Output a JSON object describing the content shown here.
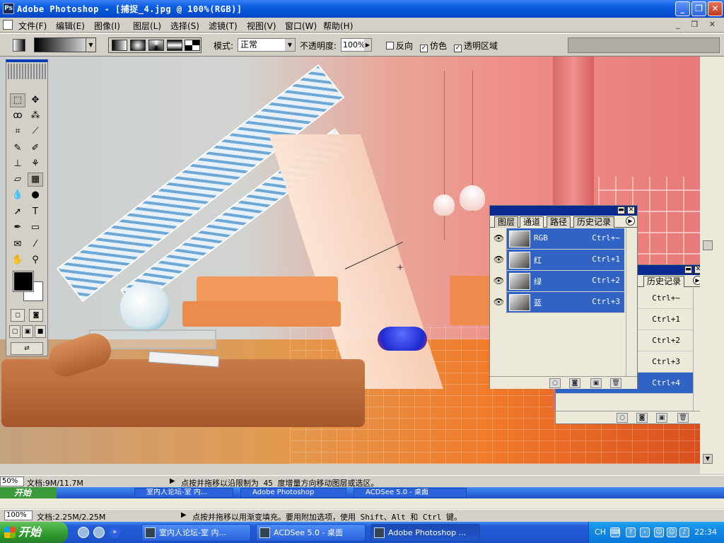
{
  "window": {
    "title": "Adobe Photoshop - [捕捉_4.jpg @ 100%(RGB)]",
    "buttons": [
      "_",
      "❐",
      "✕"
    ]
  },
  "menu": {
    "items": [
      "文件(F)",
      "编辑(E)",
      "图像(I)",
      "图层(L)",
      "选择(S)",
      "滤镜(T)",
      "视图(V)",
      "窗口(W)",
      "帮助(H)"
    ],
    "mdi_buttons": "_ ❐ ✕"
  },
  "options": {
    "mode_label": "模式:",
    "mode_value": "正常",
    "opacity_label": "不透明度:",
    "opacity_value": "100%",
    "reverse_label": "反向",
    "reverse_checked": false,
    "dither_label": "仿色",
    "dither_checked": true,
    "transparency_label": "透明区域",
    "transparency_checked": true
  },
  "channels_panel": {
    "tabs": [
      "图层",
      "通道",
      "路径",
      "历史记录"
    ],
    "active_tab": "通道",
    "rows": [
      {
        "name": "RGB",
        "shortcut": "Ctrl+~"
      },
      {
        "name": "红",
        "shortcut": "Ctrl+1"
      },
      {
        "name": "绿",
        "shortcut": "Ctrl+2"
      },
      {
        "name": "蓝",
        "shortcut": "Ctrl+3"
      }
    ]
  },
  "history_panel": {
    "tab": "历史记录",
    "rows": [
      {
        "shortcut": "Ctrl+~",
        "selected": false
      },
      {
        "shortcut": "Ctrl+1",
        "selected": false
      },
      {
        "shortcut": "Ctrl+2",
        "selected": false
      },
      {
        "shortcut": "Ctrl+3",
        "selected": false
      },
      {
        "shortcut": "Ctrl+4",
        "selected": true
      }
    ]
  },
  "status_inner": {
    "zoom": "50%",
    "doc": "文档:9M/11.7M",
    "tip": "点按并拖移以沿限制为 45 度增量方向移动图层或选区。"
  },
  "status_outer": {
    "zoom": "100%",
    "doc": "文档:2.25M/2.25M",
    "tip": "点按并拖移以用渐变填充。要用附加选项，使用 Shift、Alt 和 Ctrl 键。"
  },
  "ghost_taskbar": {
    "start": "开始",
    "buttons": [
      "室内人论坛-室 内...",
      "Adobe Photoshop",
      "ACDSee 5.0 - 桌面"
    ]
  },
  "taskbar": {
    "start": "开始",
    "buttons": [
      {
        "label": "室内人论坛-室 内...",
        "active": false
      },
      {
        "label": "ACDSee 5.0 - 桌面",
        "active": false
      },
      {
        "label": "Adobe Photoshop ...",
        "active": true
      }
    ],
    "tray": {
      "lang": "CH",
      "clock": "22:34"
    }
  }
}
